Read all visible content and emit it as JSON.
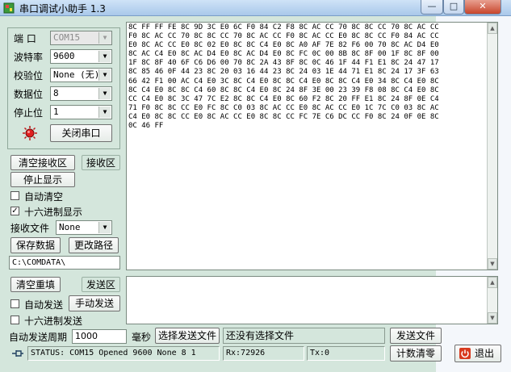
{
  "window": {
    "title": "串口调试小助手 1.3",
    "minimize": "—",
    "maximize": "□",
    "close": "✕"
  },
  "settings": {
    "port_label": "端  口",
    "port_value": "COM15",
    "baud_label": "波特率",
    "baud_value": "9600",
    "parity_label": "校验位",
    "parity_value": "None (无)",
    "databits_label": "数据位",
    "databits_value": "8",
    "stopbits_label": "停止位",
    "stopbits_value": "1",
    "close_port_button": "关闭串口"
  },
  "receive": {
    "clear_button": "清空接收区",
    "area_label": "接收区",
    "stop_display_button": "停止显示",
    "auto_clear_label": "自动清空",
    "auto_clear_checked": false,
    "hex_display_label": "十六进制显示",
    "hex_display_checked": true,
    "file_label": "接收文件",
    "file_format_value": "None",
    "save_button": "保存数据",
    "change_path_button": "更改路径",
    "path_value": "C:\\COMDATA\\",
    "lines": [
      "8C FF FF FE 8C 9D 3C E0 6C F0 84 C2 F8 8C AC CC 70 8C 8C CC 70 8C AC CC",
      "F0 8C AC CC 70 8C 8C CC 70 8C AC CC F0 8C AC CC E0 8C 8C CC F0 84 AC CC",
      "E0 8C AC CC E0 8C 02 E0 8C 8C C4 E0 8C A0 AF 7E 82 F6 00 70 8C AC D4 E0",
      "8C AC C4 E0 8C AC D4 E0 8C AC D4 E0 8C FC 0C 00 8B 8C 8F 00 1F 8C 8F 00",
      "1F 8C 8F 40 6F C6 D6 00 70 8C 2A 43 8F 8C 0C 46 1F 44 F1 E1 8C 24 47 17",
      "8C 85 46 0F 44 23 8C 20 03 16 44 23 8C 24 03 1E 44 71 E1 8C 24 17 3F 63",
      "66 42 F1 00 AC C4 E0 3C 8C C4 E0 8C 8C C4 E0 8C 8C C4 E0 34 8C C4 E0 8C",
      "8C C4 E0 8C 8C C4 60 8C 8C C4 E0 8C 24 8F 3E 00 23 39 F8 08 8C C4 E0 8C",
      "CC C4 E0 8C 3C 47 7C E2 8C 8C C4 E0 8C 60 F2 8C 20 FF E1 8C 24 8F 0E C4",
      "71 F0 8C 8C CC E0 FC 8C C0 03 8C AC CC E0 8C AC CC E0 1C 7C C0 03 8C AC",
      "C4 E0 8C 8C CC E0 8C AC CC E0 8C 8C CC FC 7E C6 DC CC F0 8C 24 0F 0E 8C",
      "0C 46 FF"
    ]
  },
  "send": {
    "clear_button": "清空重填",
    "area_label": "发送区",
    "auto_send_label": "自动发送",
    "auto_send_checked": false,
    "manual_send_button": "手动发送",
    "hex_send_label": "十六进制发送",
    "hex_send_checked": false,
    "period_label": "自动发送周期",
    "period_value": "1000",
    "period_unit": "毫秒",
    "choose_file_button": "选择发送文件",
    "file_status": "还没有选择文件",
    "send_file_button": "发送文件",
    "reset_count_button": "计数清零",
    "exit_button": "退出"
  },
  "statusbar": {
    "status_text": "STATUS: COM15 Opened 9600 None  8 1",
    "rx_text": "Rx:72926",
    "tx_text": "Tx:0"
  },
  "colors": {
    "panel_bg": "#d4e6dc",
    "led_red": "#e02020",
    "exit_icon": "#d83a1e"
  },
  "icons": {
    "app": "serial-app-icon",
    "led": "port-led-icon",
    "pin": "pin-icon",
    "exit": "power-icon"
  }
}
